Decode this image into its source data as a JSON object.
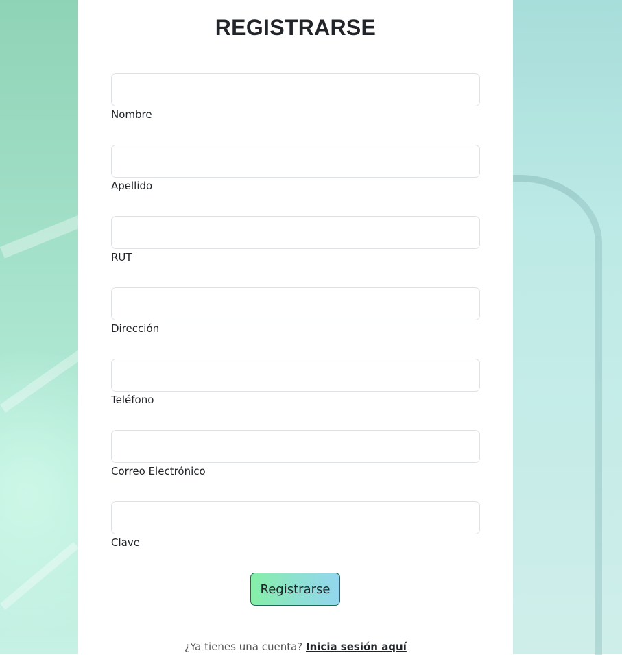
{
  "form": {
    "title": "REGISTRARSE",
    "fields": [
      {
        "label": "Nombre",
        "value": ""
      },
      {
        "label": "Apellido",
        "value": ""
      },
      {
        "label": "RUT",
        "value": ""
      },
      {
        "label": "Dirección",
        "value": ""
      },
      {
        "label": "Teléfono",
        "value": ""
      },
      {
        "label": "Correo Electrónico",
        "value": ""
      },
      {
        "label": "Clave",
        "value": ""
      }
    ],
    "submit_label": "Registrarse"
  },
  "footer": {
    "prompt": "¿Ya tienes una cuenta?",
    "link_label": "Inicia sesión aquí"
  },
  "colors": {
    "button_gradient_start": "#86efa8",
    "button_gradient_end": "#92d6ef",
    "background_green": "#a7e3cd"
  }
}
